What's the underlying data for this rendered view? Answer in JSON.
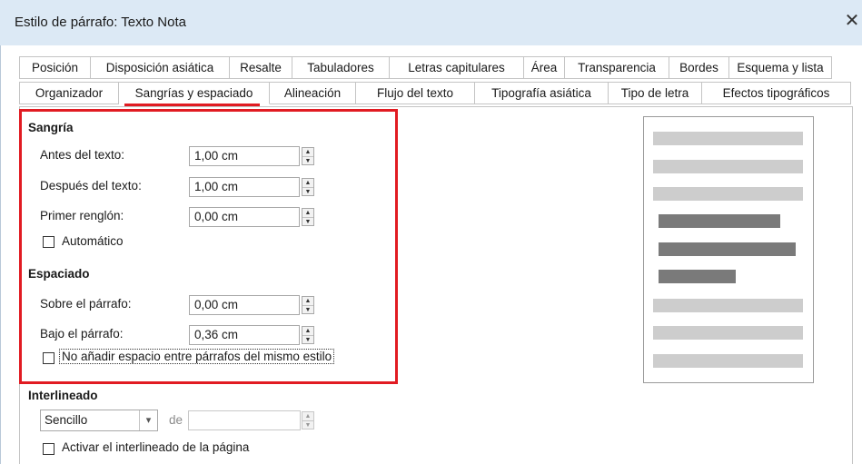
{
  "window": {
    "title": "Estilo de párrafo: Texto  Nota"
  },
  "tabs_row1": [
    "Posición",
    "Disposición asiática",
    "Resalte",
    "Tabuladores",
    "Letras capitulares",
    "Área",
    "Transparencia",
    "Bordes",
    "Esquema y lista"
  ],
  "tabs_row2": [
    "Organizador",
    "Sangrías y espaciado",
    "Alineación",
    "Flujo del texto",
    "Tipografía asiática",
    "Tipo de letra",
    "Efectos tipográficos"
  ],
  "active_tab": "Sangrías y espaciado",
  "indent": {
    "title": "Sangría",
    "before_label": "Antes del texto:",
    "before_value": "1,00 cm",
    "after_label": "Después del texto:",
    "after_value": "1,00 cm",
    "first_label": "Primer renglón:",
    "first_value": "0,00 cm",
    "auto_label": "Automático"
  },
  "spacing": {
    "title": "Espaciado",
    "above_label": "Sobre el párrafo:",
    "above_value": "0,00 cm",
    "below_label": "Bajo el párrafo:",
    "below_value": "0,36 cm",
    "no_space_label": "No añadir espacio entre párrafos del mismo estilo"
  },
  "line_spacing": {
    "title": "Interlineado",
    "select_value": "Sencillo",
    "of_label": "de",
    "of_value": "",
    "page_spacing_label": "Activar el interlineado de la página"
  },
  "colors": {
    "highlight": "#e11b22",
    "titlebar": "#dce9f5"
  },
  "icons": {
    "close": "close-icon",
    "spin": "spin-arrows-icon",
    "dropdown": "chevron-down-icon"
  }
}
